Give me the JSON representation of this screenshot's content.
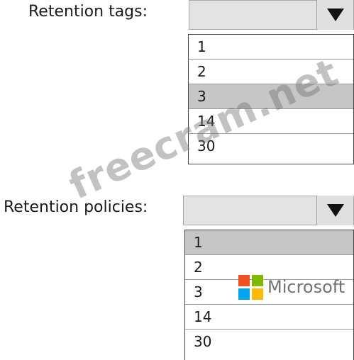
{
  "retention_tags": {
    "label": "Retention tags:",
    "selected_value": "",
    "options": [
      "1",
      "2",
      "3",
      "14",
      "30"
    ],
    "highlighted_option": "3"
  },
  "retention_policies": {
    "label": "Retention policies:",
    "selected_value": "",
    "options": [
      "1",
      "2",
      "3",
      "14",
      "30"
    ],
    "highlighted_option": "1"
  },
  "watermark_text": "freecram.net",
  "ms_logo": {
    "text": "Microsoft",
    "colors": [
      "#f25022",
      "#7fba00",
      "#00a4ef",
      "#ffb900"
    ]
  },
  "dropdown_icon": "triangle-down-icon"
}
